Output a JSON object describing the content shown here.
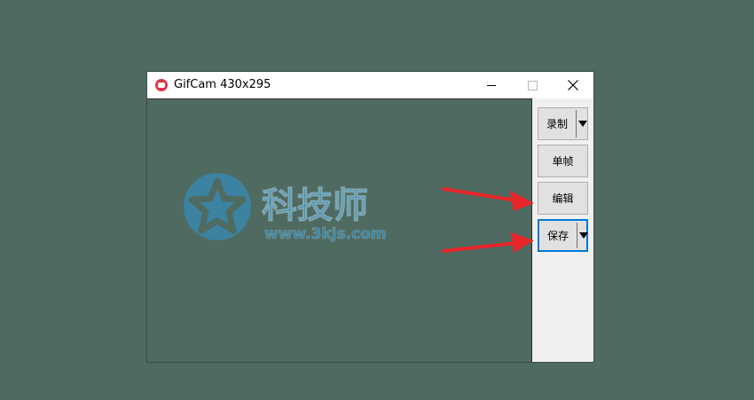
{
  "window": {
    "title": "GifCam 430x295"
  },
  "buttons": {
    "record": "录制",
    "frame": "单帧",
    "edit": "编辑",
    "save": "保存"
  },
  "watermark": {
    "brand": "科技师",
    "url": "www.3kjs.com"
  },
  "colors": {
    "background": "#4f6a60",
    "accent_blue": "#0078d7",
    "arrow_red": "#e8262a",
    "watermark_blue": "#3a86a8"
  }
}
